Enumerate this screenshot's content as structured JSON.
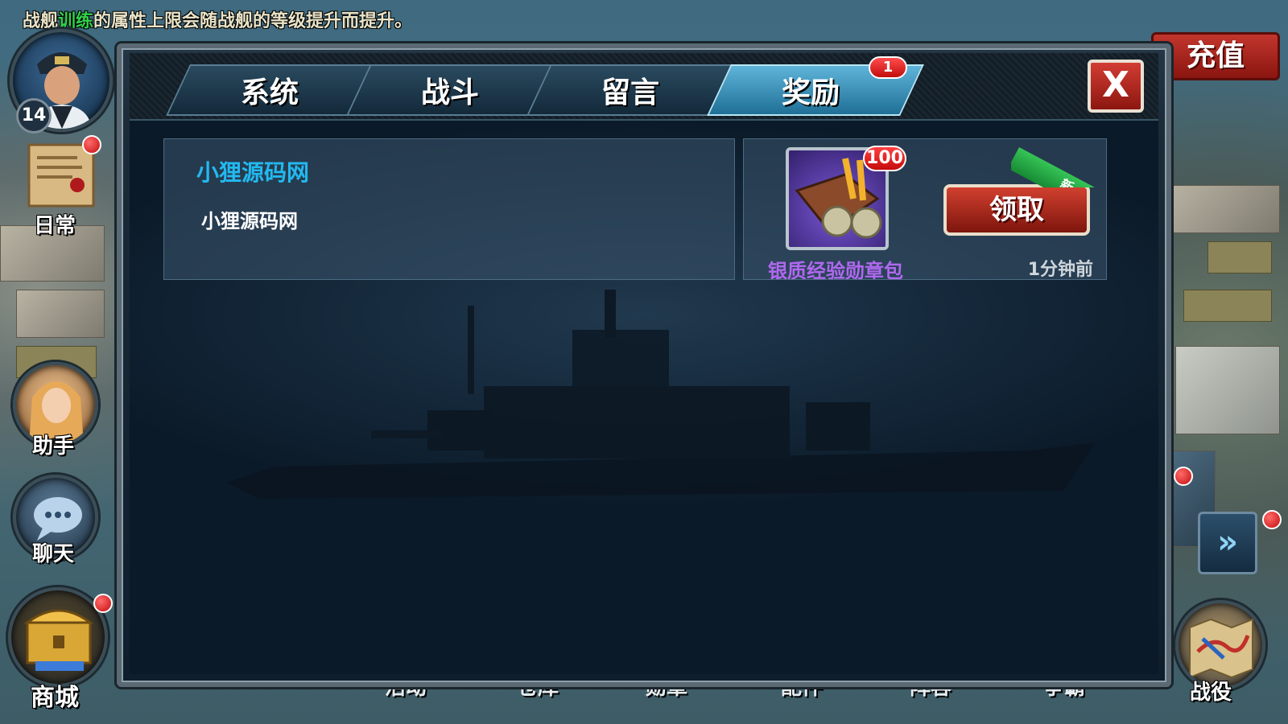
{
  "notice": {
    "prefix": "战舰",
    "highlight": "训练",
    "suffix": "的属性上限会随战舰的等级提升而提升。"
  },
  "player": {
    "level": "14"
  },
  "left_menu": [
    {
      "label": "日常"
    },
    {
      "label": "助手"
    },
    {
      "label": "聊天"
    },
    {
      "label": "商城"
    }
  ],
  "recharge_label": "充值",
  "tabs": [
    {
      "label": "系统"
    },
    {
      "label": "战斗"
    },
    {
      "label": "留言"
    },
    {
      "label": "奖励",
      "badge": "1"
    }
  ],
  "close_label": "X",
  "message": {
    "title": "小狸源码网",
    "body": "小狸源码网"
  },
  "reward": {
    "item_name": "银质经验勋章包",
    "quantity": "100",
    "new_label": "新",
    "claim_label": "领取",
    "time_ago": "1分钟前"
  },
  "bottom_menu": [
    {
      "label": "活动"
    },
    {
      "label": "仓库"
    },
    {
      "label": "勋章"
    },
    {
      "label": "配件"
    },
    {
      "label": "阵容"
    },
    {
      "label": "争霸"
    }
  ],
  "right_menu": {
    "campaign_label": "战役"
  },
  "colors": {
    "accent_blue": "#22b9f0",
    "item_purple": "#b068f0",
    "notice_green": "#33d14a",
    "badge_red": "#c20d0d"
  }
}
